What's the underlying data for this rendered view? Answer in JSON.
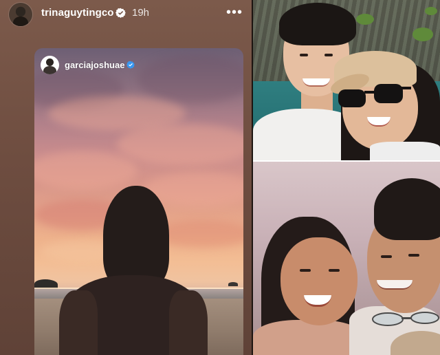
{
  "story": {
    "username": "trinaguytingco",
    "timestamp": "19h",
    "more_label": "•••",
    "verified": true,
    "reshared_post": {
      "username": "garciajoshuae",
      "verified": true
    }
  },
  "icons": {
    "verified_badge": "verified-icon",
    "more": "more-options-icon"
  },
  "colors": {
    "verified_blue": "#3897f0",
    "story_background": "#6e4d40",
    "text": "#ffffff"
  }
}
